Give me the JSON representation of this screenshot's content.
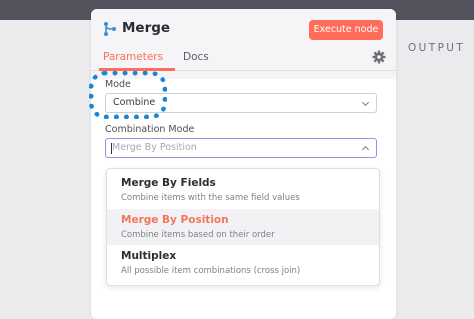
{
  "node": {
    "title": "Merge",
    "icon": "merge-branch-icon",
    "execute_label": "Execute node"
  },
  "tabs": [
    {
      "label": "Parameters",
      "active": true
    },
    {
      "label": "Docs",
      "active": false
    }
  ],
  "output_label": "OUTPUT",
  "fields": {
    "mode": {
      "label": "Mode",
      "value": "Combine"
    },
    "combination_mode": {
      "label": "Combination Mode",
      "placeholder": "Merge By Position"
    }
  },
  "dropdown": {
    "options": [
      {
        "title": "Merge By Fields",
        "description": "Combine items with the same field values"
      },
      {
        "title": "Merge By Position",
        "description": "Combine items based on their order",
        "highlighted": true
      },
      {
        "title": "Multiplex",
        "description": "All possible item combinations (cross join)"
      }
    ]
  },
  "colors": {
    "accent": "#ff6d5a",
    "highlight_outline": "#1a86d6",
    "focus_border": "#9b92e8",
    "top_bar": "#53525d"
  }
}
